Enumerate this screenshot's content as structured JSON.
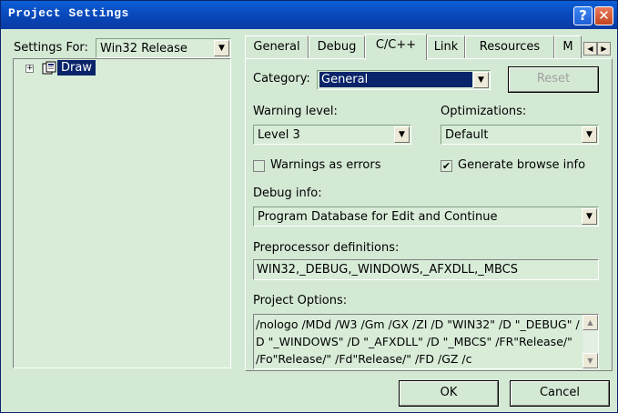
{
  "window": {
    "title": "Project Settings",
    "help_label": "?",
    "close_label": "✕"
  },
  "left_pane": {
    "settings_for_label": "Settings For:",
    "settings_for_value": "Win32 Release",
    "tree": {
      "expander": "+",
      "project_label": "Draw"
    }
  },
  "tabs": [
    {
      "label": "General"
    },
    {
      "label": "Debug"
    },
    {
      "label": "C/C++",
      "active": true
    },
    {
      "label": "Link"
    },
    {
      "label": "Resources"
    },
    {
      "label": "M"
    }
  ],
  "tab_scroll": {
    "left": "◀",
    "right": "▶"
  },
  "cpp": {
    "category_label": "Category:",
    "category_value": "General",
    "reset_label": "Reset",
    "warning_level_label": "Warning level:",
    "warning_level_value": "Level 3",
    "optimizations_label": "Optimizations:",
    "optimizations_value": "Default",
    "warnings_as_errors_label": "Warnings as errors",
    "warnings_as_errors_checked": false,
    "generate_browse_info_label": "Generate browse info",
    "generate_browse_info_checked": true,
    "debug_info_label": "Debug info:",
    "debug_info_value": "Program Database for Edit and Continue",
    "preprocessor_label": "Preprocessor definitions:",
    "preprocessor_value": "WIN32,_DEBUG,_WINDOWS,_AFXDLL,_MBCS",
    "project_options_label": "Project Options:",
    "project_options_value": "/nologo /MDd /W3 /Gm /GX /ZI /D \"WIN32\" /D \"_DEBUG\" /D \"_WINDOWS\" /D \"_AFXDLL\" /D \"_MBCS\" /FR\"Release/\" /Fo\"Release/\" /Fd\"Release/\" /FD /GZ /c"
  },
  "footer": {
    "ok_label": "OK",
    "cancel_label": "Cancel"
  },
  "colors": {
    "title_bar": "#0a4fc4",
    "dialog_bg": "#d4e9d4",
    "selection": "#0a246a"
  }
}
